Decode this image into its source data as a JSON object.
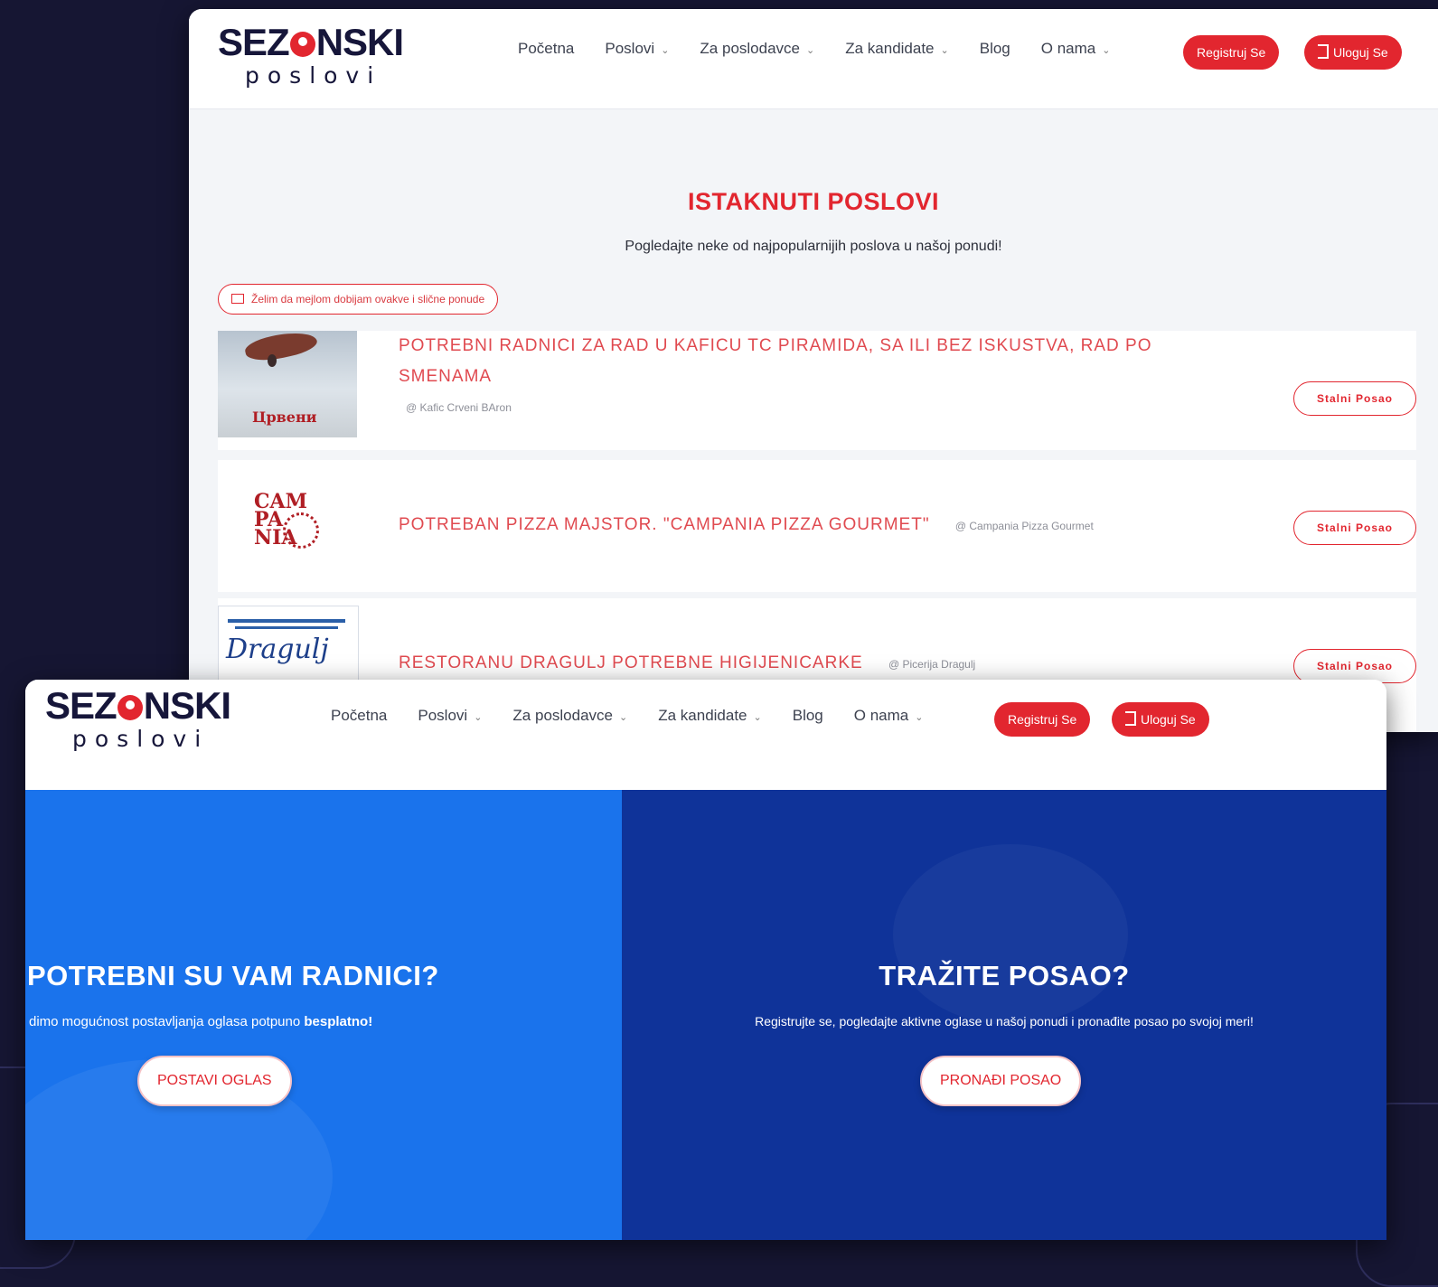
{
  "colors": {
    "background": "#161633",
    "accent": "#e2262f",
    "hero_left": "#1a73ec",
    "hero_right": "#0f3399"
  },
  "logo": {
    "top_left": "SEZ",
    "top_right": "NSKI",
    "bottom": "poslovi"
  },
  "nav": {
    "home": "Početna",
    "jobs": "Poslovi",
    "employers": "Za poslodavce",
    "candidates": "Za kandidate",
    "blog": "Blog",
    "about": "O nama",
    "register": "Registruj Se",
    "login": "Uloguj Se"
  },
  "featured": {
    "title": "ISTAKNUTI POSLOVI",
    "subtitle": "Pogledajte neke od najpopularnijih poslova u našoj ponudi!",
    "alert_button": "Želim da mejlom dobijam ovakve i slične ponude",
    "jobs": [
      {
        "title_line1": "POTREBNI RADNICI ZA RAD U KAFICU TC PIRAMIDA, SA ILI BEZ ISKUSTVA, RAD PO",
        "title_line2": "SMENAMA",
        "company": "@ Kafic Crveni BAron",
        "type": "Stalni Posao",
        "image_text": "Црвени"
      },
      {
        "title": "POTREBAN PIZZA MAJSTOR. \"CAMPANIA PIZZA GOURMET\"",
        "company": "@ Campania Pizza Gourmet",
        "type": "Stalni Posao",
        "image_text": "CAM PA NIA"
      },
      {
        "title": "RESTORANU DRAGULJ POTREBNE HIGIJENICARKE",
        "company": "@ Picerija Dragulj",
        "type": "Stalni Posao",
        "image_text": "Dragulj"
      }
    ]
  },
  "hero": {
    "left": {
      "title": "POTREBNI SU VAM RADNICI?",
      "text_plain": "dimo  mogućnost postavljanja oglasa potpuno ",
      "text_bold": "besplatno!",
      "button": "POSTAVI OGLAS"
    },
    "right": {
      "title": "TRAŽITE POSAO?",
      "text": "Registrujte se, pogledajte aktivne oglase u našoj ponudi i pronađite posao po svojoj meri!",
      "button": "PRONAĐI POSAO"
    }
  }
}
